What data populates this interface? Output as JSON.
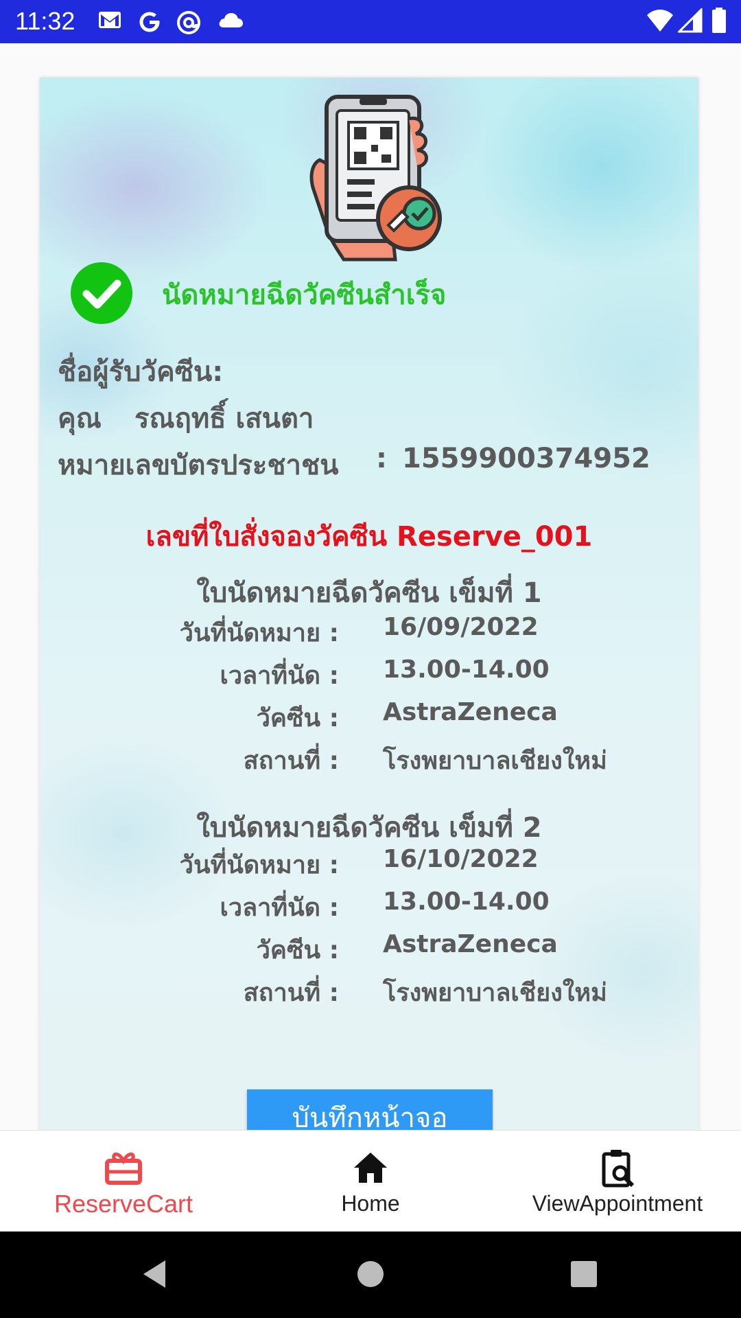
{
  "status_bar": {
    "time": "11:32",
    "icons": [
      "gmail-icon",
      "google-icon",
      "at-sign-icon",
      "cloud-icon",
      "wifi-icon",
      "signal-icon",
      "battery-icon"
    ]
  },
  "card": {
    "success_message": "นัดหมายฉีดวัคซีนสำเร็จ",
    "recipient_label": "ชื่อผู้รับวัคซีน:",
    "recipient_title": "คุณ",
    "recipient_name": "รณฤทธิ์ เสนตา",
    "id_label": "หมายเลขบัตรประชาชน",
    "id_colon": ":",
    "id_value": "1559900374952",
    "reserve_line": "เลขที่ใบสั่งจองวัคซีน Reserve_001",
    "doses": [
      {
        "title": "ใบนัดหมายฉีดวัคซีน เข็มที่ 1",
        "date_label": "วันที่นัดหมาย :",
        "date_value": "16/09/2022",
        "time_label": "เวลาที่นัด :",
        "time_value": "13.00-14.00",
        "vaccine_label": "วัคซีน :",
        "vaccine_value": "AstraZeneca",
        "place_label": "สถานที่ :",
        "place_value": "โรงพยาบาลเชียงใหม่"
      },
      {
        "title": "ใบนัดหมายฉีดวัคซีน เข็มที่ 2",
        "date_label": "วันที่นัดหมาย :",
        "date_value": "16/10/2022",
        "time_label": "เวลาที่นัด :",
        "time_value": "13.00-14.00",
        "vaccine_label": "วัคซีน :",
        "vaccine_value": "AstraZeneca",
        "place_label": "สถานที่ :",
        "place_value": "โรงพยาบาลเชียงใหม่"
      }
    ],
    "save_button": "บันทึกหน้าจอ"
  },
  "bottom_nav": {
    "items": [
      {
        "label": "ReserveCart",
        "icon": "gift-box-icon",
        "active": true
      },
      {
        "label": "Home",
        "icon": "home-icon",
        "active": false
      },
      {
        "label": "ViewAppointment",
        "icon": "clipboard-search-icon",
        "active": false
      }
    ]
  },
  "colors": {
    "status_bar": "#1f2bdc",
    "success": "#2bc22b",
    "reserve": "#e3121c",
    "button": "#2e9af5",
    "nav_active": "#f0484c"
  }
}
